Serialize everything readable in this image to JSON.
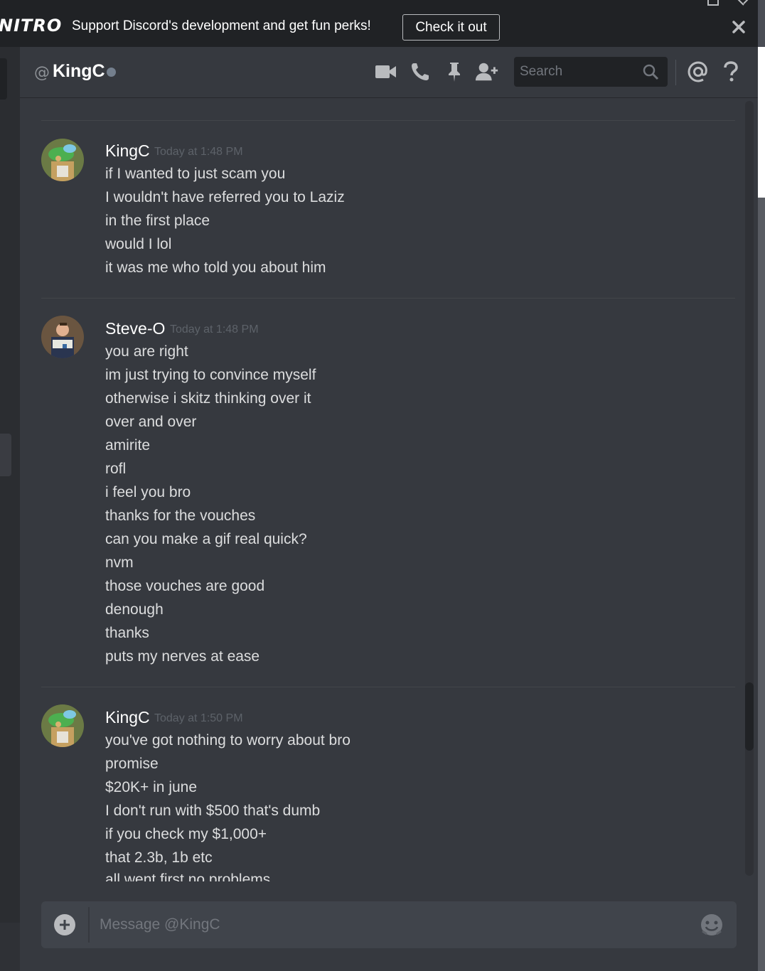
{
  "banner": {
    "logo": "NITRO",
    "text": "Support Discord's development and get fun perks!",
    "button": "Check it out"
  },
  "header": {
    "at_symbol": "@",
    "username": "KingC",
    "search_placeholder": "Search",
    "icons": [
      "video-call-icon",
      "voice-call-icon",
      "pin-icon",
      "add-friend-icon",
      "search-icon",
      "mention-icon",
      "help-icon"
    ]
  },
  "messages": [
    {
      "author": "KingC",
      "timestamp": "Today at 1:48 PM",
      "lines": [
        "if I wanted to just scam you",
        "I wouldn't have referred you to Laziz",
        "in the first place",
        "would I lol",
        "it was me who told you about him"
      ]
    },
    {
      "author": "Steve-O",
      "timestamp": "Today at 1:48 PM",
      "lines": [
        "you are right",
        "im just trying to convince myself",
        "otherwise i skitz thinking over it",
        "over and over",
        "amirite",
        "rofl",
        "i feel you bro",
        "thanks for the vouches",
        "can you make a gif real quick?",
        "nvm",
        "those vouches are good",
        "denough",
        "thanks",
        "puts my nerves at ease"
      ]
    },
    {
      "author": "KingC",
      "timestamp": "Today at 1:50 PM",
      "lines": [
        "you've got nothing to worry about bro",
        "promise",
        "$20K+ in june",
        "I don't run with $500 that's dumb",
        "if you check my $1,000+",
        "that 2.3b, 1b etc",
        "all went first no problems"
      ]
    }
  ],
  "composer": {
    "placeholder": "Message @KingC"
  },
  "colors": {
    "background": "#36393f",
    "banner": "#202225",
    "accent": "#7289da"
  }
}
